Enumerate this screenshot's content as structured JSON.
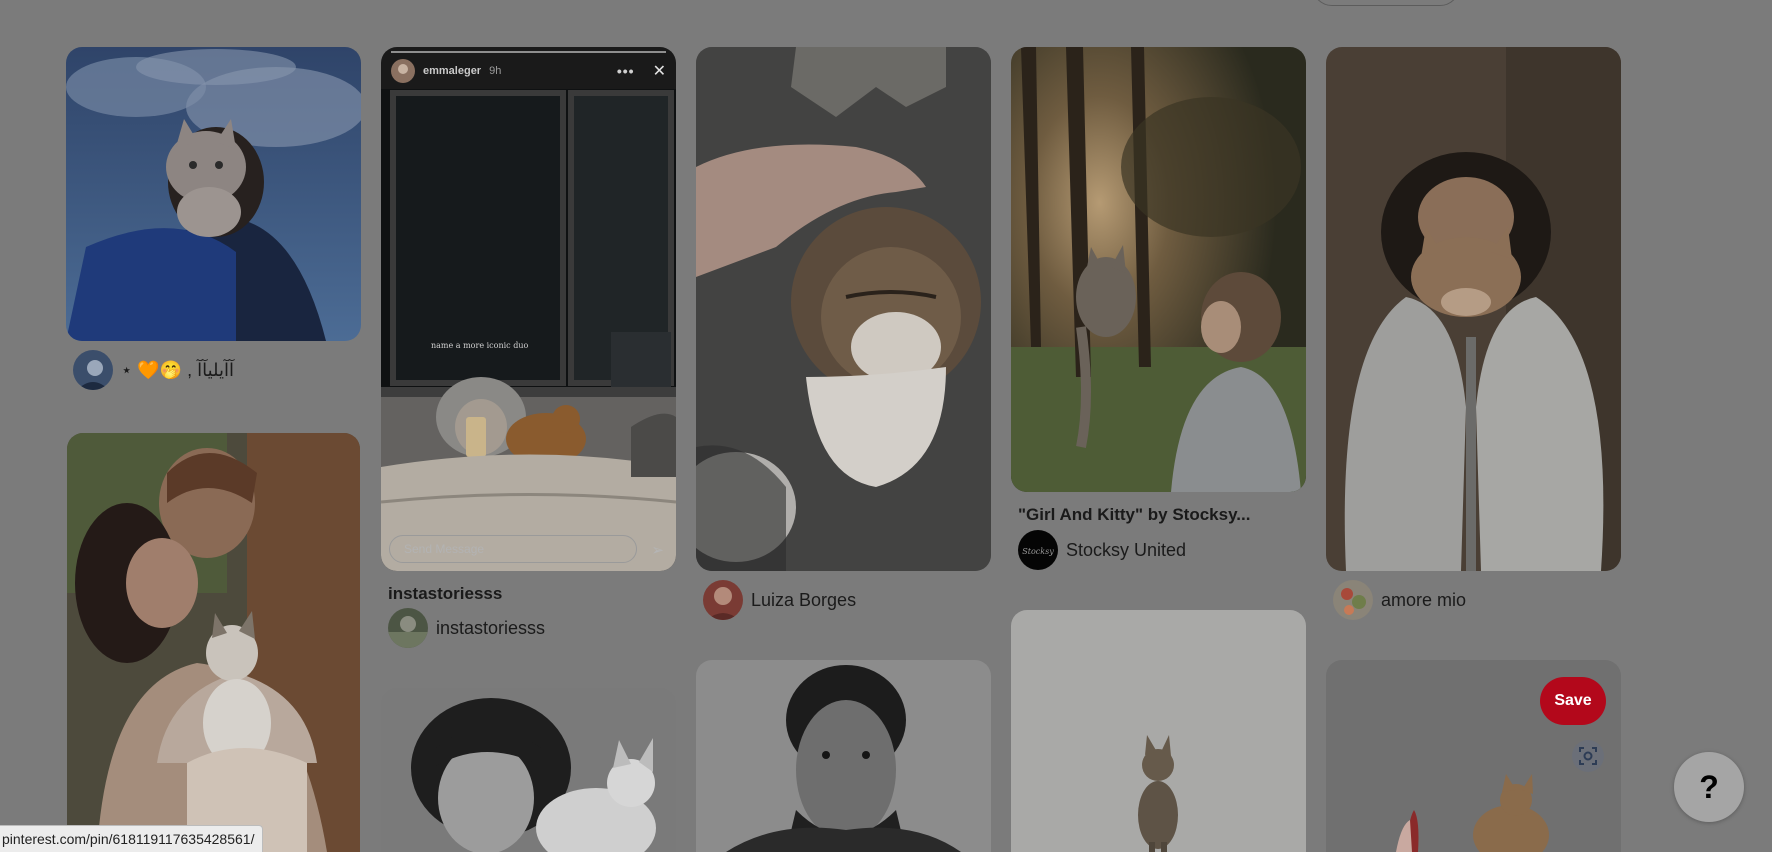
{
  "colors": {
    "overlay_bg": "#7b7b7b",
    "save_button": "#b3081b",
    "help_button": "#a5a5a5"
  },
  "pins": {
    "p1": {
      "creator": "⋆ 🧡🤭 , آآيليآآ"
    },
    "p2": {
      "title": "instastoriesss",
      "creator": "instastoriesss",
      "story": {
        "username": "emmaleger",
        "time": "9h",
        "caption": "name a more iconic duo",
        "message_placeholder": "Send Message"
      }
    },
    "p3": {
      "creator": "Luiza Borges"
    },
    "p4": {
      "title": "\"Girl And Kitty\" by Stocksy...",
      "creator": "Stocksy United",
      "avatar_text": "Stocksy"
    },
    "p5": {
      "creator": "amore mio"
    }
  },
  "actions": {
    "save_label": "Save",
    "help_label": "?"
  },
  "icons": {
    "lens": "visual-search-icon",
    "send": "send-icon",
    "close": "close-icon",
    "more": "more-icon"
  },
  "status_bar": {
    "url": "pinterest.com/pin/618119117635428561/"
  }
}
